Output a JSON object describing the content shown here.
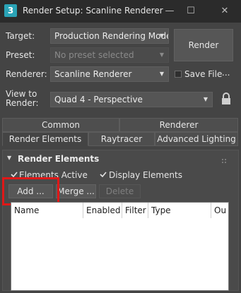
{
  "window": {
    "app_icon_text": "3",
    "title": "Render Setup: Scanline Renderer",
    "minimize_glyph": "—",
    "maximize_glyph": "☐",
    "close_glyph": "✕"
  },
  "form": {
    "target_label": "Target:",
    "target_value": "Production Rendering Mode",
    "preset_label": "Preset:",
    "preset_placeholder": "No preset selected",
    "renderer_label": "Renderer:",
    "renderer_value": "Scanline Renderer",
    "save_file_label": "Save File",
    "ellipsis": "...",
    "view_label_line1": "View to",
    "view_label_line2": "Render:",
    "view_value": "Quad 4 - Perspective",
    "render_button": "Render"
  },
  "tabs": {
    "row1": [
      "Common",
      "Renderer"
    ],
    "row2": [
      "Render Elements",
      "Raytracer",
      "Advanced Lighting"
    ],
    "active": "Render Elements"
  },
  "rollout": {
    "title": "Render Elements",
    "elements_active_label": "Elements Active",
    "display_elements_label": "Display Elements",
    "add_button": "Add ...",
    "merge_button": "Merge ...",
    "delete_button": "Delete",
    "columns": [
      "Name",
      "Enabled",
      "Filter",
      "Type",
      "Ou"
    ]
  },
  "icons": {
    "dropdown": "chevron-down-icon",
    "lock": "lock-icon",
    "collapse": "collapse-triangle-icon",
    "check": "checkmark-icon"
  },
  "colors": {
    "background": "#444444",
    "titlebar": "#2b2b2b",
    "app_icon": "#2aa3b6",
    "highlight": "#e01818"
  }
}
